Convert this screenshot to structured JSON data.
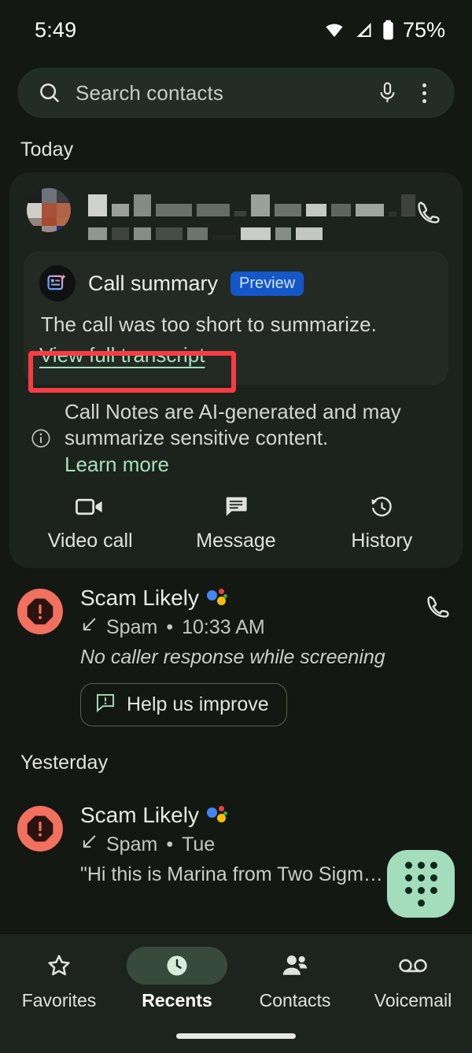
{
  "status_bar": {
    "time": "5:49",
    "battery_percent": "75%",
    "wifi_icon": "wifi-icon",
    "signal_icon": "cellular-signal-icon",
    "battery_icon": "battery-icon"
  },
  "search": {
    "placeholder": "Search contacts",
    "search_icon": "search-icon",
    "mic_icon": "microphone-icon",
    "overflow_icon": "overflow-menu-icon"
  },
  "sections": {
    "today_label": "Today",
    "yesterday_label": "Yesterday"
  },
  "call_card": {
    "contact_name_redacted": "",
    "call_icon": "phone-call-icon",
    "summary": {
      "icon": "call-summary-sparkle-icon",
      "title": "Call summary",
      "badge": "Preview",
      "body": "The call was too short to summarize.",
      "link": "View full transcript",
      "link_highlighted": true
    },
    "disclaimer": {
      "info_icon": "info-icon",
      "text": "Call Notes are AI-generated and may summarize sensitive content.",
      "link": "Learn more"
    },
    "actions": [
      {
        "label": "Video call",
        "icon": "video-camera-icon"
      },
      {
        "label": "Message",
        "icon": "message-bubble-icon"
      },
      {
        "label": "History",
        "icon": "history-clock-icon"
      }
    ]
  },
  "call_log": [
    {
      "name": "Scam Likely",
      "badge_icon": "google-assistant-icon",
      "warning_icon": "spam-warning-icon",
      "direction_icon": "incoming-call-arrow-icon",
      "type": "Spam",
      "separator": "•",
      "time": "10:33 AM",
      "note": "No caller response while screening",
      "note_italic": true,
      "chip_label": "Help us improve",
      "chip_icon": "feedback-icon",
      "trailing_icon": "phone-call-icon",
      "section": "today"
    },
    {
      "name": "Scam Likely",
      "badge_icon": "google-assistant-icon",
      "warning_icon": "spam-warning-icon",
      "direction_icon": "incoming-call-arrow-icon",
      "type": "Spam",
      "separator": "•",
      "time": "Tue",
      "note": "\"Hi this is Marina from Two Sigm…",
      "note_italic": false,
      "section": "yesterday"
    }
  ],
  "fab": {
    "name": "dialpad-fab",
    "icon": "dialpad-icon",
    "color": "#a3ddbb"
  },
  "bottom_nav": {
    "items": [
      {
        "label": "Favorites",
        "icon": "star-icon",
        "active": false
      },
      {
        "label": "Recents",
        "icon": "clock-icon",
        "active": true
      },
      {
        "label": "Contacts",
        "icon": "people-icon",
        "active": false
      },
      {
        "label": "Voicemail",
        "icon": "voicemail-icon",
        "active": false
      }
    ]
  },
  "annotation": {
    "color": "#fb3b43",
    "target": "View full transcript"
  },
  "colors": {
    "page_background": "#141813",
    "card_background": "#1c231d",
    "summary_background": "#222a23",
    "accent_green": "#a6e0bd",
    "badge_blue": "#1457c8",
    "spam_red": "#f2705e",
    "annotation_red": "#fb3b43"
  }
}
